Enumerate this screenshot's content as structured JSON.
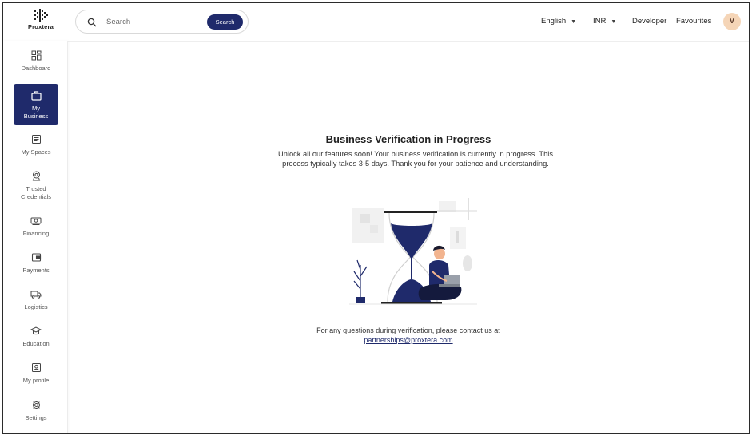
{
  "brand": {
    "name": "Proxtera"
  },
  "search": {
    "placeholder": "Search",
    "value": "",
    "button_label": "Search"
  },
  "header": {
    "language": "English",
    "currency": "INR",
    "developer_label": "Developer",
    "favourites_label": "Favourites",
    "avatar_initial": "V"
  },
  "sidebar": {
    "items": [
      {
        "label": "Dashboard",
        "icon": "dashboard-icon"
      },
      {
        "label": "My Business",
        "icon": "briefcase-icon",
        "active": true
      },
      {
        "label": "My Spaces",
        "icon": "spaces-icon"
      },
      {
        "label": "Trusted Credentials",
        "icon": "credentials-icon"
      },
      {
        "label": "Financing",
        "icon": "financing-icon"
      },
      {
        "label": "Payments",
        "icon": "wallet-icon"
      },
      {
        "label": "Logistics",
        "icon": "truck-icon"
      },
      {
        "label": "Education",
        "icon": "education-icon"
      },
      {
        "label": "My profile",
        "icon": "profile-icon"
      },
      {
        "label": "Settings",
        "icon": "settings-icon"
      }
    ]
  },
  "main": {
    "title": "Business Verification in Progress",
    "description": "Unlock all our features soon! Your business verification is currently in progress. This process typically takes 3-5 days. Thank you for your patience and understanding.",
    "contact_text": "For any questions during verification, please contact us at",
    "contact_email": "partnerships@proxtera.com"
  },
  "colors": {
    "accent": "#1f2a6b",
    "avatar_bg": "#f5d5b7"
  }
}
